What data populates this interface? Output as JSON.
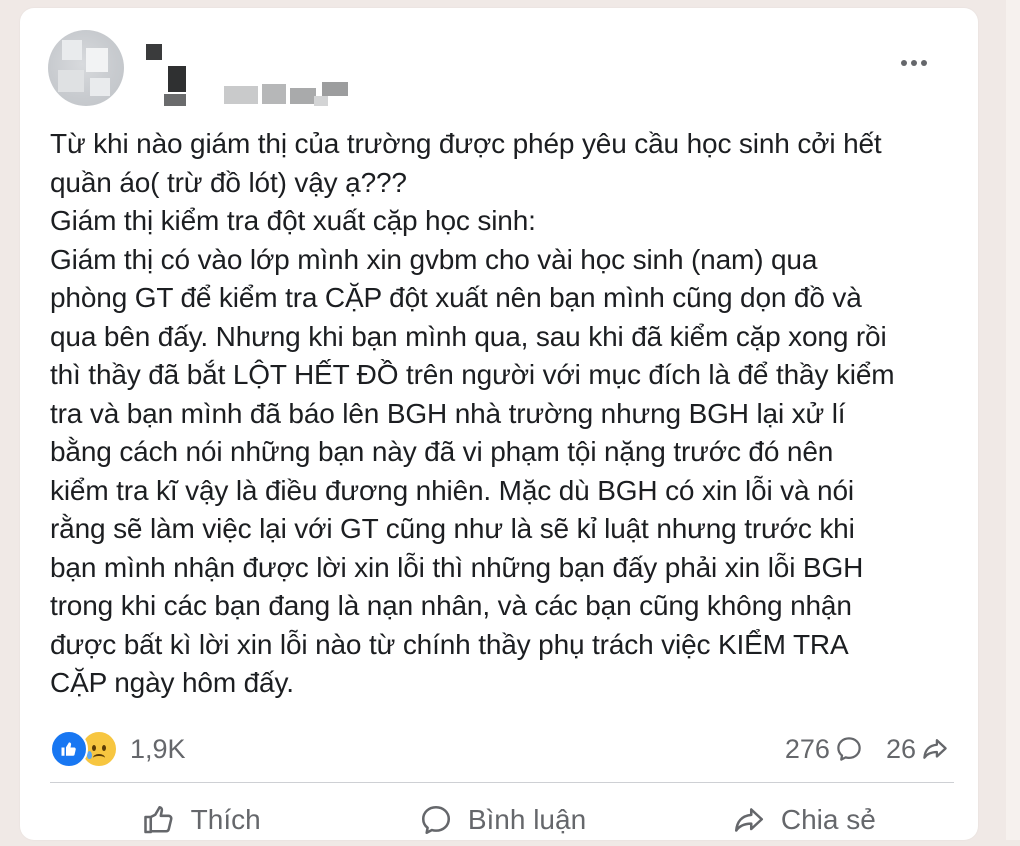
{
  "post": {
    "author_name": "",
    "text_lines": [
      "Từ khi nào giám thị của trường được phép yêu cầu học sinh cởi hết",
      "quần áo( trừ đồ lót) vậy ạ???",
      "Giám thị kiểm tra đột xuất cặp học sinh:",
      "Giám thị có vào lớp mình xin gvbm cho vài học sinh (nam) qua",
      "phòng GT để kiểm tra CẶP đột xuất nên bạn mình cũng dọn đồ và",
      "qua bên đấy. Nhưng khi bạn mình qua, sau khi đã kiểm cặp xong rồi",
      "thì thầy đã bắt LỘT HẾT ĐỒ trên người với mục đích là để thầy kiểm",
      "tra và bạn mình đã báo lên BGH nhà trường nhưng BGH lại xử lí",
      "bằng cách nói những bạn này đã vi phạm tội nặng trước đó nên",
      "kiểm tra kĩ vậy là điều đương nhiên. Mặc dù BGH có xin lỗi và nói",
      "rằng sẽ làm việc lại với GT cũng như là sẽ kỉ luật nhưng trước khi",
      "bạn mình nhận được lời xin lỗi thì những bạn đấy phải xin lỗi BGH",
      "trong khi các bạn đang là nạn nhân, và các bạn cũng không nhận",
      "được bất kì lời xin lỗi nào từ chính thầy phụ trách việc KIỂM TRA",
      "CẶP ngày hôm đấy."
    ]
  },
  "stats": {
    "reactions_count": "1,9K",
    "comments_count": "276",
    "shares_count": "26"
  },
  "actions": {
    "like_label": "Thích",
    "comment_label": "Bình luận",
    "share_label": "Chia sẻ"
  },
  "icons": {
    "more": "more-horizontal-icon",
    "like_reaction": "like-reaction-icon",
    "sad_reaction": "sad-reaction-icon",
    "comment": "comment-icon",
    "share": "share-icon",
    "like": "thumbs-up-icon"
  },
  "colors": {
    "brand_blue": "#1877f2",
    "sad_yellow": "#f7c640",
    "secondary_text": "#65676b",
    "primary_text": "#1c1e21"
  }
}
